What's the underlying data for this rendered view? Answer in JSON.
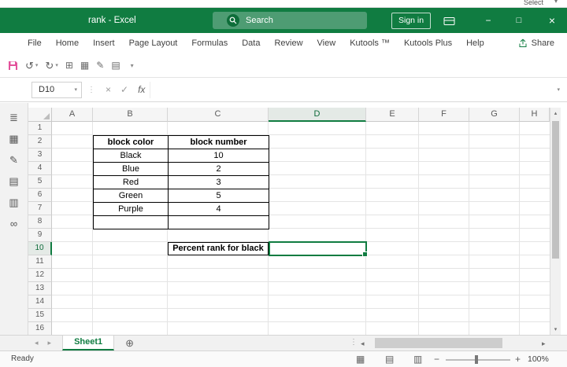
{
  "background_window": {
    "select_label": "Select"
  },
  "title_bar": {
    "title": "rank - Excel",
    "search_label": "Search",
    "sign_in_label": "Sign in"
  },
  "ribbon": {
    "tabs": [
      "File",
      "Home",
      "Insert",
      "Page Layout",
      "Formulas",
      "Data",
      "Review",
      "View",
      "Kutools ™",
      "Kutools Plus",
      "Help"
    ],
    "share_label": "Share"
  },
  "formula_bar": {
    "name_box_value": "D10",
    "formula_value": ""
  },
  "sheet": {
    "columns": [
      "A",
      "B",
      "C",
      "D",
      "E",
      "F",
      "G",
      "H"
    ],
    "row_numbers": [
      "1",
      "2",
      "3",
      "4",
      "5",
      "6",
      "7",
      "8",
      "9",
      "10",
      "11",
      "12",
      "13",
      "14",
      "15",
      "16"
    ],
    "selected_column": "D",
    "selected_row": "10",
    "selected_cell": "D10",
    "table": {
      "range": "B2:C8",
      "headers": [
        "block color",
        "block number"
      ],
      "rows": [
        [
          "Black",
          "10"
        ],
        [
          "Blue",
          "2"
        ],
        [
          "Red",
          "3"
        ],
        [
          "Green",
          "5"
        ],
        [
          "Purple",
          "4"
        ],
        [
          "",
          ""
        ]
      ]
    },
    "labels": [
      {
        "cell": "C10",
        "text": "Percent rank for black"
      }
    ]
  },
  "tab_bar": {
    "sheets": [
      {
        "name": "Sheet1",
        "active": true
      }
    ]
  },
  "status_bar": {
    "ready_label": "Ready",
    "zoom_level": "100%"
  },
  "colors": {
    "accent_green": "#107C41",
    "save_icon_pink": "#E3519B"
  },
  "icons": {
    "minimize": "−",
    "maximize": "□",
    "close": "×",
    "undo": "↺",
    "redo": "↻",
    "dropdown": "▾",
    "cancel": "×",
    "confirm": "✓",
    "fx": "fx",
    "dots": "⋮",
    "nav_prev": "◂",
    "nav_next": "▸",
    "add_sheet": "⊕",
    "scroll_up": "▴",
    "scroll_down": "▾",
    "scroll_left": "◂",
    "scroll_right": "▸",
    "normal_view": "▦",
    "page_layout_view": "▤",
    "page_break_view": "▥",
    "zoom_out": "−",
    "zoom_in": "+",
    "sidebar_menu": "≣",
    "sidebar_grid": "▦",
    "sidebar_pencil": "✎",
    "sidebar_printer": "▤",
    "sidebar_table": "▥",
    "sidebar_binoculars": "∞",
    "qat_table": "⊞",
    "qat_grid": "▦",
    "qat_pencil": "✎",
    "qat_page": "▤"
  }
}
